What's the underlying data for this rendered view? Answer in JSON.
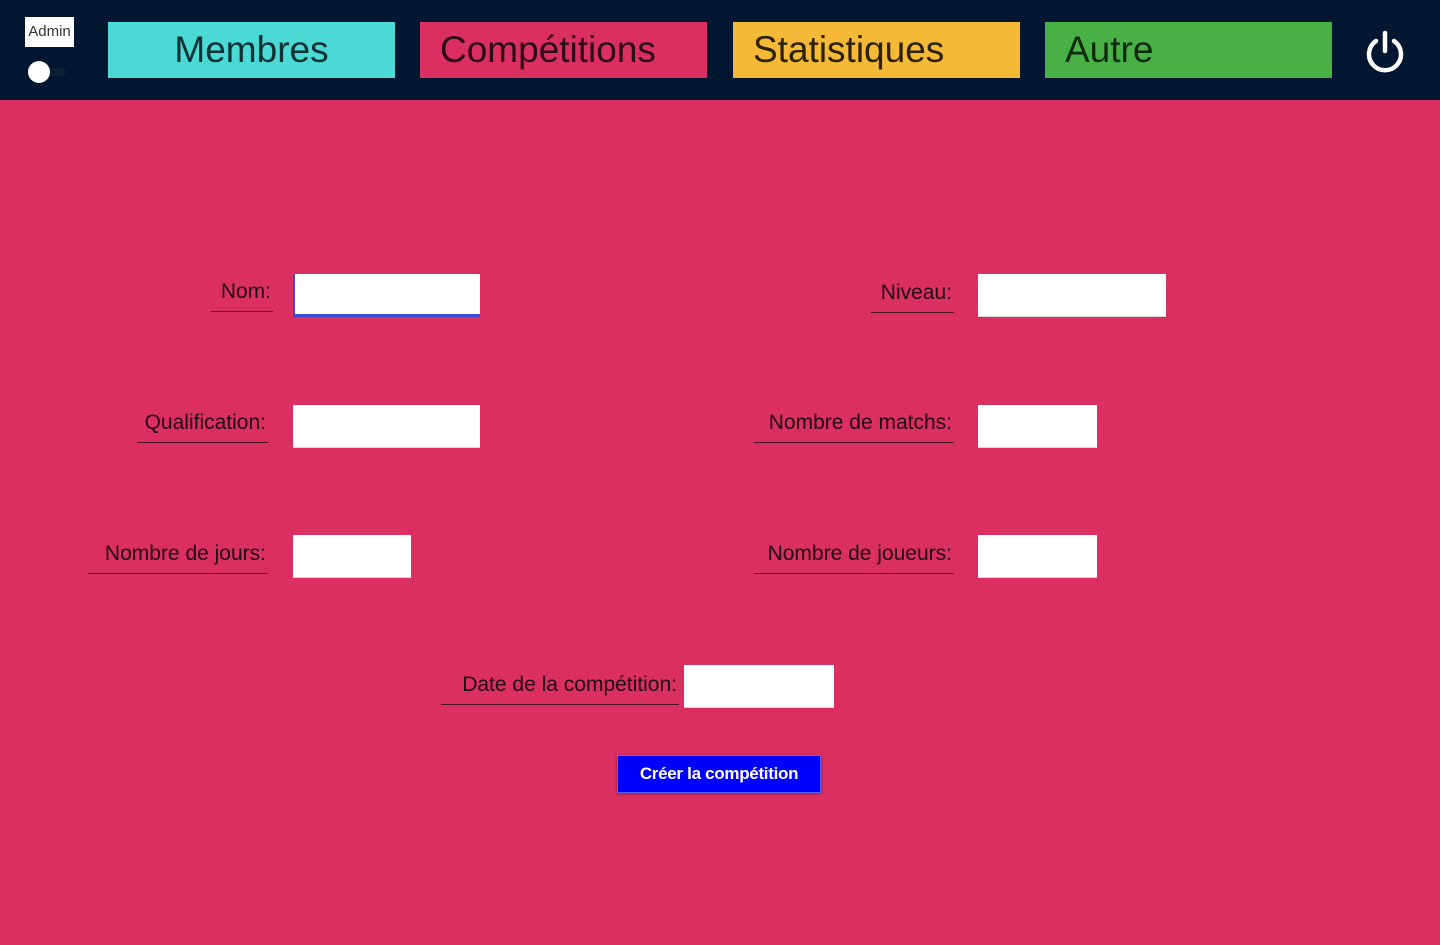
{
  "header": {
    "admin_label": "Admin",
    "admin_toggle_on": false,
    "tabs": [
      {
        "label": "Membres",
        "color": "#4ad9d5"
      },
      {
        "label": "Compétitions",
        "color": "#dc2f61"
      },
      {
        "label": "Statistiques",
        "color": "#f5b938"
      },
      {
        "label": "Autre",
        "color": "#48b044"
      }
    ],
    "power_icon": "power-icon",
    "background": "#011631"
  },
  "form": {
    "background": "#dc2f61",
    "fields": {
      "nom": {
        "label": "Nom:",
        "value": ""
      },
      "niveau": {
        "label": "Niveau:",
        "value": ""
      },
      "qualification": {
        "label": "Qualification:",
        "value": ""
      },
      "nombre_matchs": {
        "label": "Nombre de matchs:",
        "value": ""
      },
      "nombre_jours": {
        "label": "Nombre de jours:",
        "value": ""
      },
      "nombre_joueurs": {
        "label": "Nombre de joueurs:",
        "value": ""
      },
      "date": {
        "label": "Date de la compétition:",
        "value": ""
      }
    },
    "submit_label": "Créer la compétition",
    "submit_color": "#0000ff"
  }
}
